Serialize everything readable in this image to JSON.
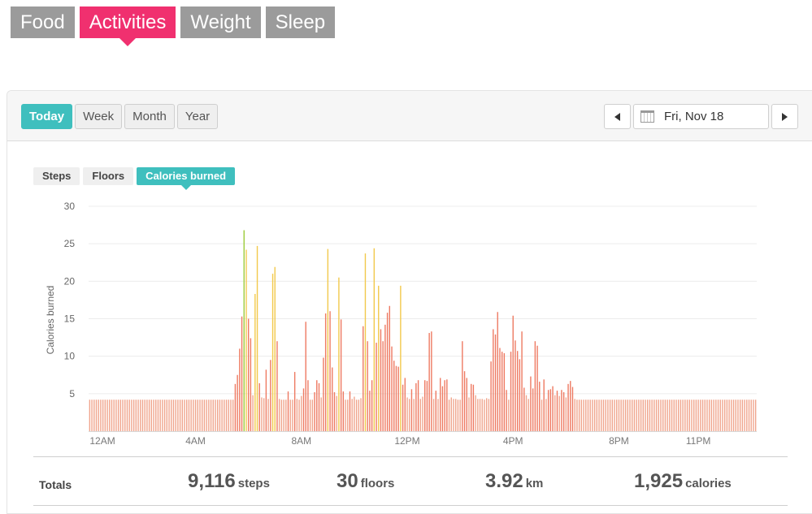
{
  "top_tabs": [
    "Food",
    "Activities",
    "Weight",
    "Sleep"
  ],
  "active_top_tab": "Activities",
  "range_tabs": [
    "Today",
    "Week",
    "Month",
    "Year"
  ],
  "active_range": "Today",
  "date": "Fri, Nov 18",
  "metric_tabs": [
    "Steps",
    "Floors",
    "Calories burned"
  ],
  "active_metric": "Calories burned",
  "colors": {
    "accent_pink": "#f0306f",
    "accent_teal": "#3fbfbe",
    "bar_base": "#f0a58d",
    "bar_mid": "#ee7a62",
    "bar_high": "#f2c94c",
    "bar_peak": "#9ccc3a"
  },
  "chart_data": {
    "type": "bar",
    "ylabel": "Calories burned",
    "ylim": [
      0,
      30
    ],
    "y_ticks": [
      5,
      10,
      15,
      20,
      25,
      30
    ],
    "x_tick_labels": [
      "12AM",
      "4AM",
      "8AM",
      "12PM",
      "4PM",
      "8PM",
      "11PM"
    ],
    "x_tick_hours": [
      0,
      4,
      8,
      12,
      16,
      20,
      23
    ],
    "interval_minutes": 5,
    "values": [
      4.2,
      4.2,
      4.2,
      4.2,
      4.2,
      4.2,
      4.2,
      4.2,
      4.2,
      4.2,
      4.2,
      4.2,
      4.2,
      4.2,
      4.2,
      4.2,
      4.2,
      4.2,
      4.2,
      4.2,
      4.2,
      4.2,
      4.2,
      4.2,
      4.2,
      4.2,
      4.2,
      4.2,
      4.2,
      4.2,
      4.2,
      4.2,
      4.2,
      4.2,
      4.2,
      4.2,
      4.2,
      4.2,
      4.2,
      4.2,
      4.2,
      4.2,
      4.2,
      4.2,
      4.2,
      4.2,
      4.2,
      4.2,
      4.2,
      4.2,
      4.2,
      4.2,
      4.2,
      4.2,
      4.2,
      4.2,
      4.2,
      4.2,
      4.2,
      4.2,
      4.2,
      4.2,
      4.2,
      4.2,
      4.2,
      4.2,
      6.3,
      7.5,
      11.0,
      15.3,
      26.8,
      24.2,
      15.0,
      12.4,
      4.8,
      18.3,
      24.7,
      6.4,
      4.5,
      4.4,
      8.2,
      4.3,
      9.5,
      21.0,
      21.9,
      12.0,
      4.3,
      4.2,
      4.2,
      4.2,
      5.3,
      4.2,
      4.2,
      7.9,
      4.3,
      4.2,
      4.7,
      5.7,
      14.6,
      6.8,
      4.2,
      4.2,
      5.2,
      6.8,
      6.4,
      4.5,
      9.8,
      15.7,
      24.3,
      16.0,
      8.5,
      5.2,
      4.7,
      20.5,
      14.9,
      5.3,
      4.2,
      4.2,
      5.3,
      4.3,
      4.6,
      4.2,
      4.2,
      4.4,
      14.0,
      23.7,
      12.0,
      5.4,
      6.8,
      24.4,
      11.8,
      19.4,
      13.6,
      12.0,
      14.2,
      15.8,
      16.7,
      11.3,
      9.4,
      8.7,
      8.6,
      19.4,
      6.2,
      7.1,
      4.5,
      4.3,
      5.6,
      4.3,
      6.4,
      6.8,
      4.3,
      4.6,
      6.8,
      6.7,
      13.1,
      13.3,
      4.3,
      5.4,
      4.3,
      7.1,
      6.0,
      6.8,
      6.9,
      4.2,
      4.5,
      4.3,
      4.3,
      4.2,
      4.2,
      12.0,
      8.0,
      7.1,
      4.5,
      6.3,
      6.2,
      4.8,
      4.3,
      4.3,
      4.3,
      4.2,
      4.4,
      4.3,
      9.3,
      13.6,
      12.9,
      15.9,
      11.1,
      10.6,
      10.4,
      5.5,
      4.2,
      10.6,
      15.4,
      12.1,
      10.7,
      9.6,
      13.3,
      5.8,
      4.8,
      4.3,
      7.3,
      5.7,
      12.0,
      11.4,
      6.6,
      4.2,
      6.9,
      4.3,
      5.5,
      5.6,
      6.0,
      4.8,
      5.4,
      4.7,
      5.5,
      5.2,
      4.5,
      6.3,
      6.7,
      5.9,
      4.3,
      4.2,
      4.2,
      4.2,
      4.2,
      4.2,
      4.2,
      4.2,
      4.2,
      4.2,
      4.2,
      4.2,
      4.2,
      4.2,
      4.2,
      4.2,
      4.2,
      4.2,
      4.2,
      4.2,
      4.2,
      4.2,
      4.2,
      4.2,
      4.2,
      4.2,
      4.2,
      4.2,
      4.2,
      4.2,
      4.2,
      4.2,
      4.2,
      4.2,
      4.2,
      4.2,
      4.2,
      4.2,
      4.2,
      4.2,
      4.2,
      4.2,
      4.2,
      4.2,
      4.2,
      4.2,
      4.2,
      4.2,
      4.2,
      4.2,
      4.2,
      4.2,
      4.2,
      4.2,
      4.2,
      4.2,
      4.2,
      4.2,
      4.2,
      4.2,
      4.2,
      4.2,
      4.2,
      4.2,
      4.2,
      4.2,
      4.2,
      4.2,
      4.2,
      4.2,
      4.2,
      4.2,
      4.2,
      4.2,
      4.2,
      4.2,
      4.2,
      4.2,
      4.2,
      4.2,
      4.2,
      4.2,
      4.2
    ]
  },
  "totals": {
    "label": "Totals",
    "steps": {
      "value": "9,116",
      "unit": "steps"
    },
    "floors": {
      "value": "30",
      "unit": "floors"
    },
    "distance": {
      "value": "3.92",
      "unit": "km"
    },
    "calories": {
      "value": "1,925",
      "unit": "calories"
    }
  }
}
